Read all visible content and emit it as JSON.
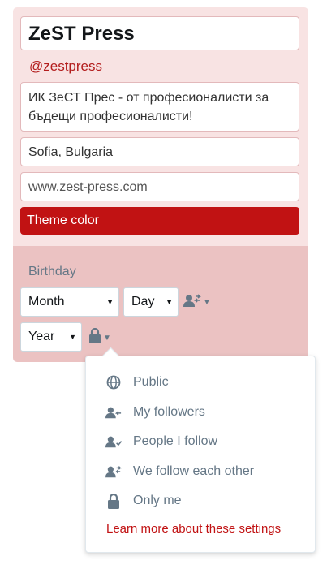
{
  "profile": {
    "name": "ZeST Press",
    "handle": "@zestpress",
    "bio": "ИК ЗеСТ Прес - от професионалисти за бъдещи професионалисти!",
    "location": "Sofia, Bulgaria",
    "website": "www.zest-press.com",
    "theme_color_label": "Theme color",
    "theme_color": "#c11213"
  },
  "birthday": {
    "label": "Birthday",
    "month": "Month",
    "day": "Day",
    "year": "Year"
  },
  "privacy_menu": {
    "items": [
      {
        "label": "Public",
        "icon": "globe-icon"
      },
      {
        "label": "My followers",
        "icon": "followers-icon"
      },
      {
        "label": "People I follow",
        "icon": "following-icon"
      },
      {
        "label": "We follow each other",
        "icon": "mutual-follow-icon"
      },
      {
        "label": "Only me",
        "icon": "lock-icon"
      }
    ],
    "learn_more": "Learn more about these settings"
  },
  "colors": {
    "accent": "#c11213",
    "top_bg": "#f8e3e3",
    "bottom_bg": "#ebc2c2",
    "muted": "#657786"
  }
}
